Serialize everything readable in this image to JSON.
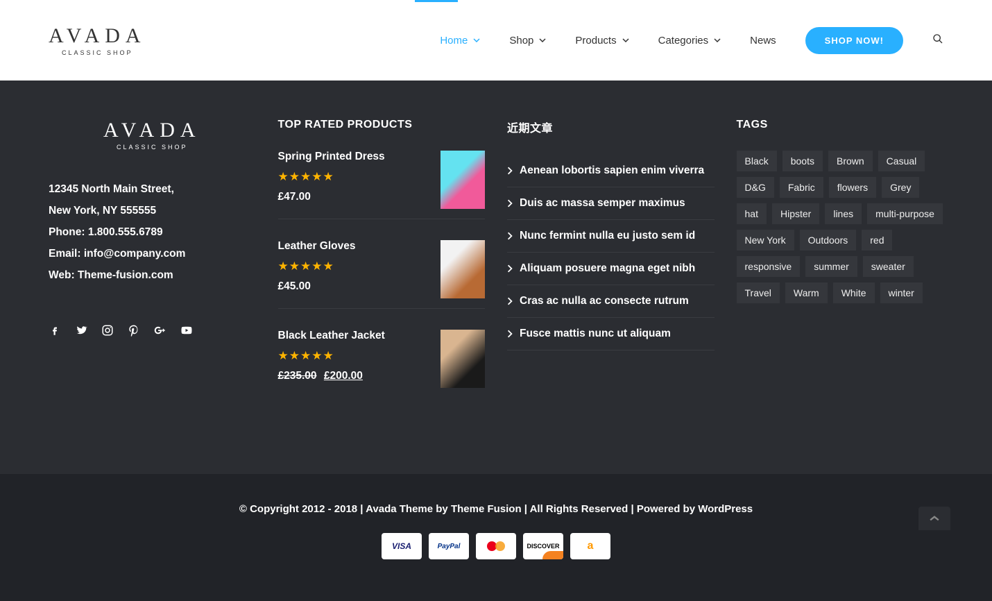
{
  "brand": {
    "name": "AVADA",
    "tagline": "CLASSIC SHOP"
  },
  "nav": {
    "items": [
      {
        "label": "Home",
        "active": true,
        "dropdown": true
      },
      {
        "label": "Shop",
        "active": false,
        "dropdown": true
      },
      {
        "label": "Products",
        "active": false,
        "dropdown": true
      },
      {
        "label": "Categories",
        "active": false,
        "dropdown": true
      },
      {
        "label": "News",
        "active": false,
        "dropdown": false
      }
    ],
    "shop_now": "SHOP NOW!"
  },
  "footer": {
    "contact": {
      "address1": "12345 North Main Street,",
      "address2": "New York, NY 555555",
      "phone": "Phone: 1.800.555.6789",
      "email": "Email: info@company.com",
      "web": "Web: Theme-fusion.com"
    },
    "top_rated_title": "TOP RATED PRODUCTS",
    "products": [
      {
        "title": "Spring Printed Dress",
        "currency": "£",
        "price": "47.00"
      },
      {
        "title": "Leather Gloves",
        "currency": "£",
        "price": "45.00"
      },
      {
        "title": "Black Leather Jacket",
        "currency": "£",
        "old_price": "235.00",
        "price": "200.00"
      }
    ],
    "recent_title": "近期文章",
    "posts": [
      "Aenean lobortis sapien enim viverra",
      "Duis ac massa semper maximus",
      "Nunc fermint nulla eu justo sem id",
      "Aliquam posuere magna eget nibh",
      "Cras ac nulla ac consecte rutrum",
      "Fusce mattis nunc ut aliquam"
    ],
    "tags_title": "TAGS",
    "tags": [
      "Black",
      "boots",
      "Brown",
      "Casual",
      "D&G",
      "Fabric",
      "flowers",
      "Grey",
      "hat",
      "Hipster",
      "lines",
      "multi-purpose",
      "New York",
      "Outdoors",
      "red",
      "responsive",
      "summer",
      "sweater",
      "Travel",
      "Warm",
      "White",
      "winter"
    ]
  },
  "bottom": {
    "copyright_prefix": "© Copyright 2012 - 2018   |   Avada Theme by ",
    "theme_link": "Theme Fusion",
    "copyright_mid": "   |   All Rights Reserved   |   Powered by ",
    "wp_link": "WordPress",
    "pay": {
      "visa": "VISA",
      "paypal": "PayPal",
      "discover": "DISCOVER",
      "amazon": "a"
    }
  }
}
